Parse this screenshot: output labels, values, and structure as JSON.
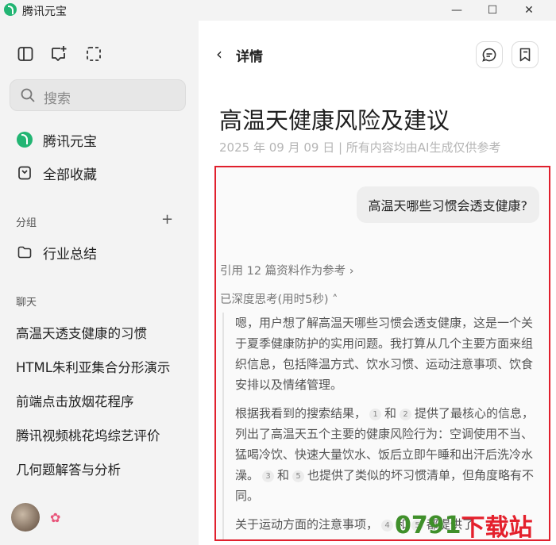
{
  "window": {
    "title": "腾讯元宝",
    "controls": {
      "minimize": "—",
      "maximize": "☐",
      "close": "✕"
    }
  },
  "sidebar": {
    "toolbar_icons": [
      "sidebar-toggle-icon",
      "new-chat-icon",
      "select-icon"
    ],
    "search": {
      "placeholder": "搜索"
    },
    "nav": [
      {
        "label": "腾讯元宝",
        "icon": "yuanbao-logo-icon"
      },
      {
        "label": "全部收藏",
        "icon": "bookmark-icon"
      }
    ],
    "groups_label": "分组",
    "groups_add": "+",
    "groups": [
      {
        "label": "行业总结",
        "icon": "folder-icon"
      }
    ],
    "chats_label": "聊天",
    "chats": [
      "高温天透支健康的习惯",
      "HTML朱利亚集合分形演示",
      "前端点击放烟花程序",
      "腾讯视频桃花坞综艺评价",
      "几何题解答与分析"
    ],
    "badge": "✿"
  },
  "main": {
    "back": "‹",
    "header_title": "详情",
    "doc_title": "高温天健康风险及建议",
    "doc_meta": "2025 年 09 月 09 日 | 所有内容均由AI生成仅供参考",
    "question": "高温天哪些习惯会透支健康?",
    "references": "引用 12 篇资料作为参考 ›",
    "thinking": "已深度思考(用时5秒) ˄",
    "reasoning": {
      "p1": "嗯，用户想了解高温天哪些习惯会透支健康，这是一个关于夏季健康防护的实用问题。我打算从几个主要方面来组织信息，包括降温方式、饮水习惯、运动注意事项、饮食安排以及情绪管理。",
      "p2_a": "根据我看到的搜索结果，",
      "p2_c1": "1",
      "p2_b": "和",
      "p2_c2": "2",
      "p2_c": "提供了最核心的信息，列出了高温天五个主要的健康风险行为：空调使用不当、猛喝冷饮、快速大量饮水、饭后立即午睡和出汗后洗冷水澡。",
      "p2_c3": "3",
      "p2_d": "和",
      "p2_c4": "5",
      "p2_e": "也提供了类似的坏习惯清单，但角度略有不同。",
      "p3_a": "关于运动方面的注意事项，",
      "p3_c1": "4",
      "p3_b": "和",
      "p3_c2": "5",
      "p3_c": "都提供了"
    }
  },
  "watermark": {
    "num": "0791",
    "text": "下载站"
  }
}
